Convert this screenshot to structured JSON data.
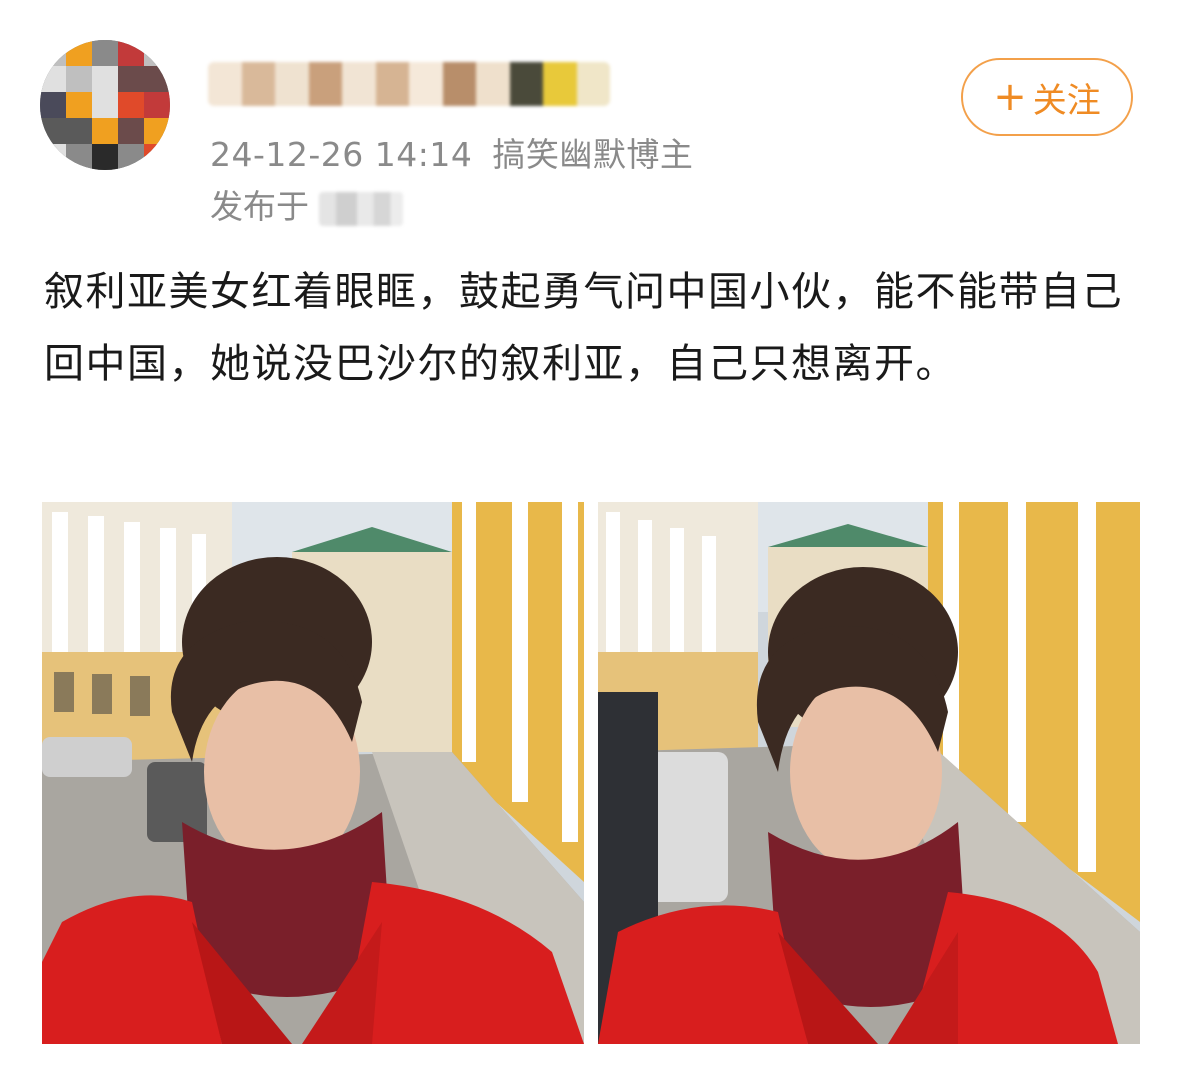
{
  "author": {
    "name": "",
    "timestamp": "24-12-26 14:14",
    "source": "搞笑幽默博主",
    "location_prefix": "发布于",
    "location": ""
  },
  "follow_button": {
    "icon": "plus-icon",
    "label": "关注"
  },
  "post": {
    "text": "叙利亚美女红着眼眶，鼓起勇气问中国小伙，能不能带自己回中国，她说没巴沙尔的叙利亚，自己只想离开。",
    "images": [
      {
        "id": "photo-1"
      },
      {
        "id": "photo-2"
      }
    ]
  },
  "colors": {
    "accent": "#ef8b24",
    "meta": "#8a8a8a",
    "text": "#1a1a1a"
  }
}
